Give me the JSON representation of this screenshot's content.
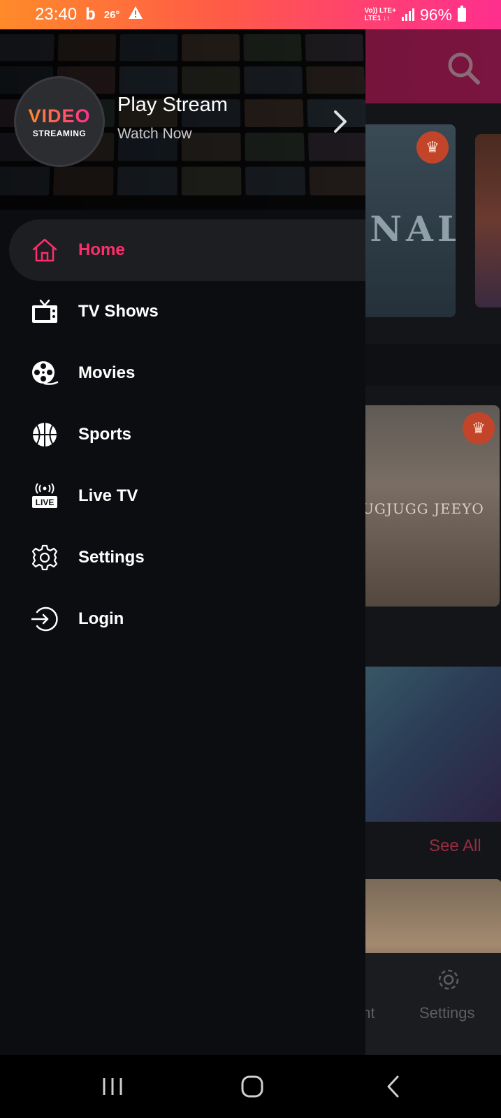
{
  "status_bar": {
    "time": "23:40",
    "b_icon": "b",
    "temperature": "26°",
    "network_top": "Vo)) LTE+",
    "network_bottom": "LTE1 ↓↑",
    "battery": "96%"
  },
  "drawer": {
    "logo_line1": "VIDEO",
    "logo_line2": "STREAMING",
    "app_name": "Play Stream",
    "subtitle": "Watch Now",
    "menu": [
      {
        "label": "Home",
        "icon": "home-icon",
        "active": true
      },
      {
        "label": "TV Shows",
        "icon": "tv-icon",
        "active": false
      },
      {
        "label": "Movies",
        "icon": "film-reel-icon",
        "active": false
      },
      {
        "label": "Sports",
        "icon": "basketball-icon",
        "active": false
      },
      {
        "label": "Live TV",
        "icon": "live-tv-icon",
        "active": false
      },
      {
        "label": "Settings",
        "icon": "gear-icon",
        "active": false
      },
      {
        "label": "Login",
        "icon": "login-icon",
        "active": false
      }
    ]
  },
  "background": {
    "card1_title": "INAL",
    "card3_title": "UGJUGG JEEYO",
    "see_all": "See All",
    "bottom_nav_partial": "unt",
    "bottom_nav_settings": "Settings"
  },
  "colors": {
    "accent": "#ff2d6c",
    "drawer_bg": "#0c0d11",
    "active_item_bg": "#1d1e22",
    "status_gradient_start": "#ff8a2a",
    "status_gradient_end": "#ff2f8e"
  }
}
